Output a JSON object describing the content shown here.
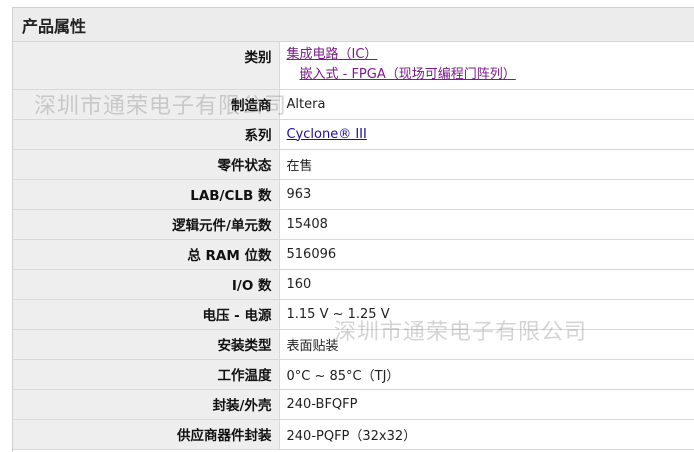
{
  "header": {
    "title": "产品属性"
  },
  "attributes": {
    "category": {
      "label": "类别",
      "link1": "集成电路（IC）",
      "link2": "嵌入式 - FPGA（现场可编程门阵列）"
    },
    "manufacturer": {
      "label": "制造商",
      "value": "Altera"
    },
    "series": {
      "label": "系列",
      "value": "Cyclone® III"
    },
    "part_status": {
      "label": "零件状态",
      "value": "在售"
    },
    "lab_clb": {
      "label": "LAB/CLB 数",
      "value": "963"
    },
    "logic_elements": {
      "label": "逻辑元件/单元数",
      "value": "15408"
    },
    "ram_bits": {
      "label": "总 RAM 位数",
      "value": "516096"
    },
    "io_count": {
      "label": "I/O 数",
      "value": "160"
    },
    "voltage": {
      "label": "电压 - 电源",
      "value": "1.15 V ~ 1.25 V"
    },
    "mount_type": {
      "label": "安装类型",
      "value": "表面贴装"
    },
    "temperature": {
      "label": "工作温度",
      "value": "0°C ~ 85°C（TJ）"
    },
    "package": {
      "label": "封装/外壳",
      "value": "240-BFQFP"
    },
    "supplier_package": {
      "label": "供应商器件封装",
      "value": "240-PQFP（32x32）"
    }
  },
  "watermark": {
    "text": "深圳市通荣电子有限公司"
  },
  "colors": {
    "link": "#1a0dab",
    "link_visited": "#7b1a8a",
    "label_bg": "#eeeeee"
  }
}
